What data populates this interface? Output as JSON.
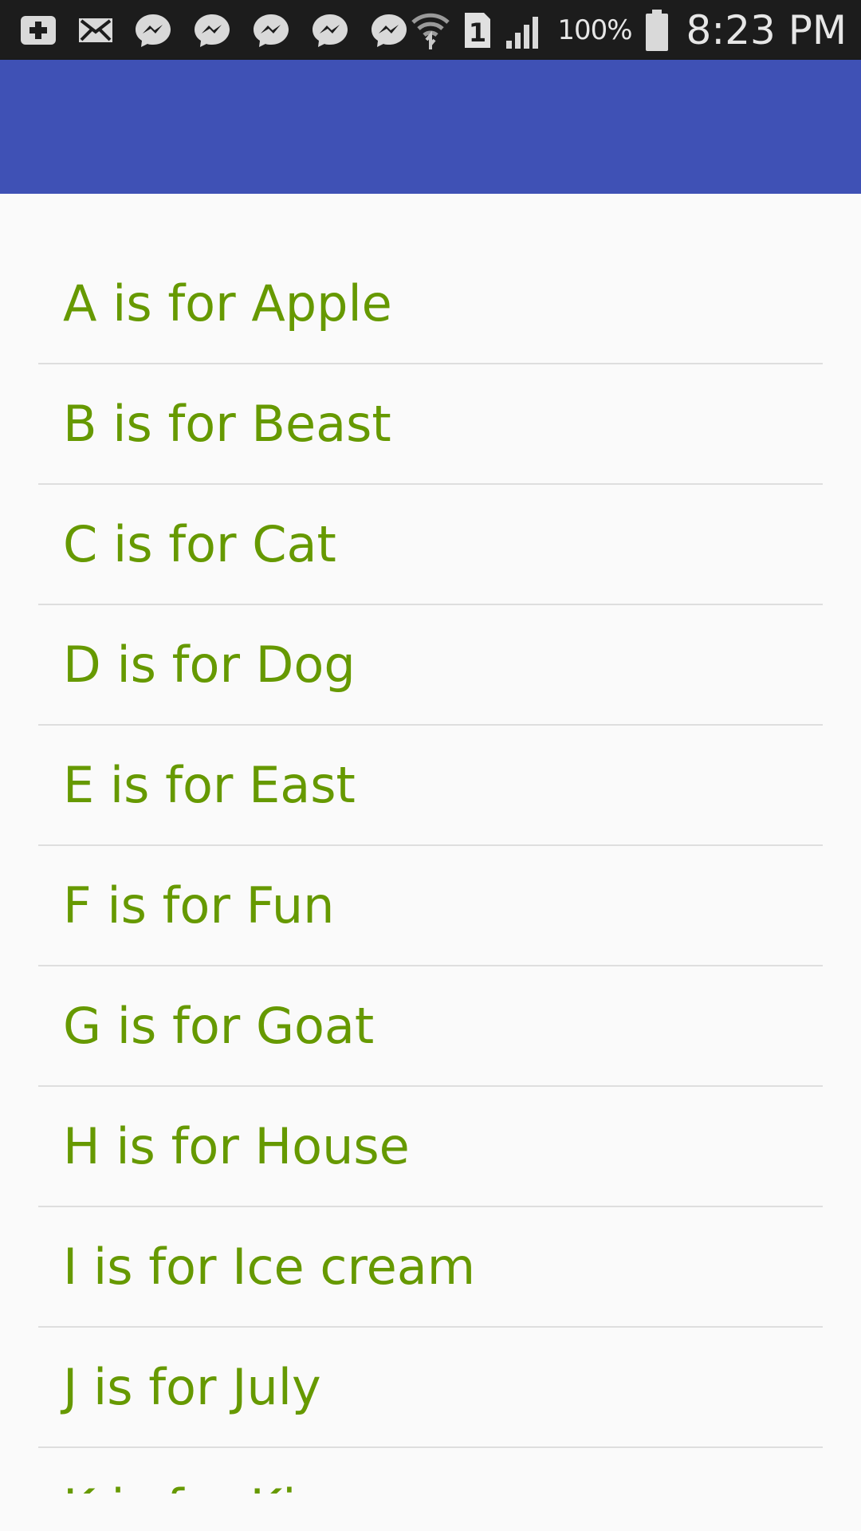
{
  "status_bar": {
    "icons": [
      "add-icon",
      "mail-icon",
      "messenger-icon",
      "messenger-icon",
      "messenger-icon",
      "messenger-icon",
      "messenger-icon",
      "wifi-icon",
      "sim-1-icon",
      "signal-icon",
      "battery-icon"
    ],
    "sim_label": "1",
    "battery_percent": "100%",
    "time": "8:23 PM"
  },
  "app_bar": {
    "color": "#3f51b5"
  },
  "list": {
    "text_color": "#669900",
    "items": [
      {
        "label": "A is for Apple"
      },
      {
        "label": "B is for Beast"
      },
      {
        "label": "C is for Cat"
      },
      {
        "label": "D is for Dog"
      },
      {
        "label": "E is for East"
      },
      {
        "label": "F is for Fun"
      },
      {
        "label": "G is for Goat"
      },
      {
        "label": "H is for House"
      },
      {
        "label": "I is for Ice cream"
      },
      {
        "label": "J is for July"
      },
      {
        "label": "K is for King"
      }
    ]
  }
}
